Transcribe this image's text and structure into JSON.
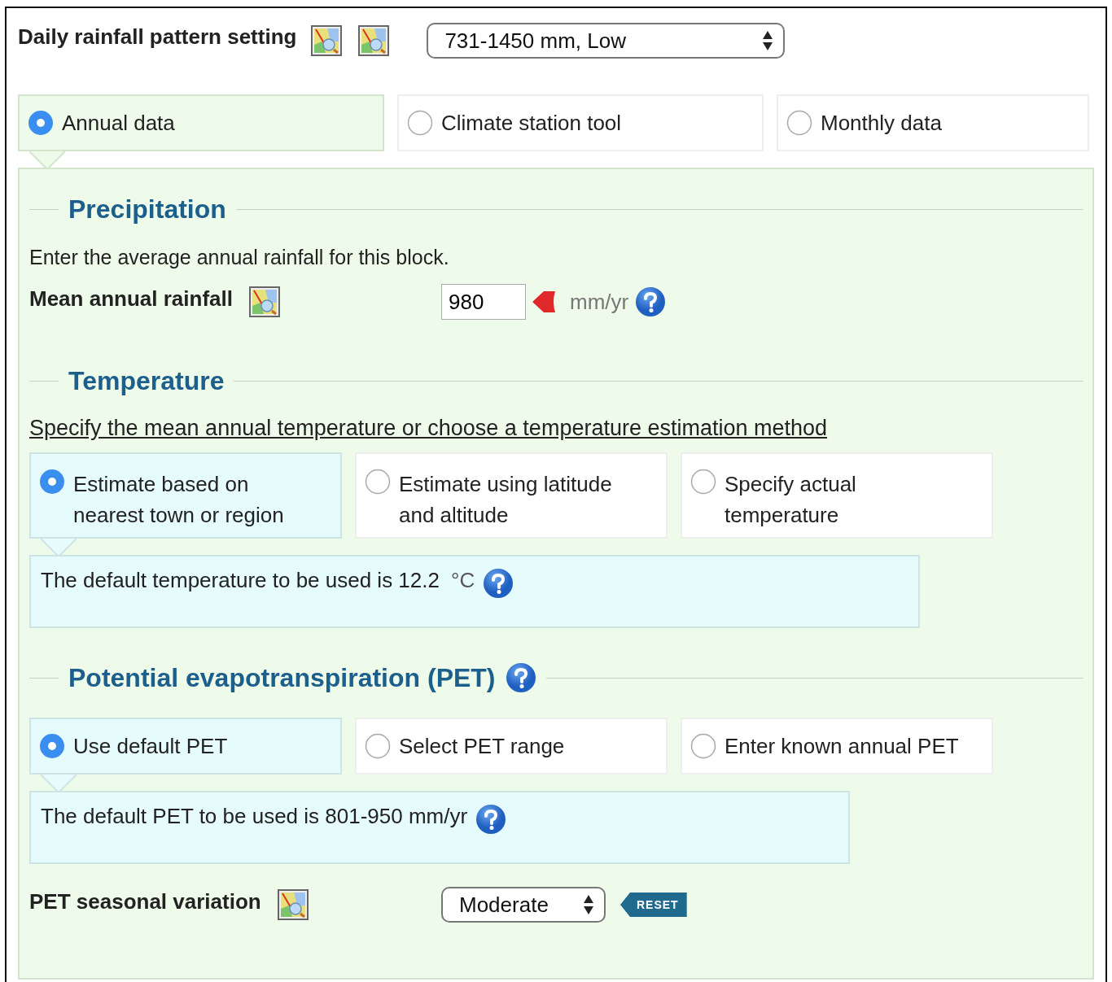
{
  "header": {
    "title": "Daily rainfall pattern setting",
    "select": {
      "value": "731-1450 mm, Low"
    }
  },
  "source_options": [
    {
      "label": "Annual data",
      "selected": true
    },
    {
      "label": "Climate station tool",
      "selected": false
    },
    {
      "label": "Monthly data",
      "selected": false
    }
  ],
  "precipitation": {
    "heading": "Precipitation",
    "description": "Enter the average annual rainfall for this block.",
    "field": {
      "label": "Mean annual rainfall",
      "value": "980",
      "unit": "mm/yr"
    }
  },
  "temperature": {
    "heading": "Temperature",
    "instruction": "Specify the mean annual temperature or choose a temperature estimation method",
    "options": [
      {
        "label": "Estimate based on nearest town or region",
        "selected": true
      },
      {
        "label": "Estimate using latitude and altitude",
        "selected": false
      },
      {
        "label": "Specify actual temperature",
        "selected": false
      }
    ],
    "info": {
      "text": "The default temperature to be used is 12.2",
      "unit": "°C"
    }
  },
  "pet": {
    "heading": "Potential evapotranspiration (PET)",
    "options": [
      {
        "label": "Use default PET",
        "selected": true
      },
      {
        "label": "Select PET range",
        "selected": false
      },
      {
        "label": "Enter known annual PET",
        "selected": false
      }
    ],
    "info": {
      "text": "The default PET to be used is 801-950 mm/yr"
    },
    "seasonal": {
      "label": "PET seasonal variation",
      "select": {
        "value": "Moderate"
      },
      "reset": "RESET"
    }
  }
}
